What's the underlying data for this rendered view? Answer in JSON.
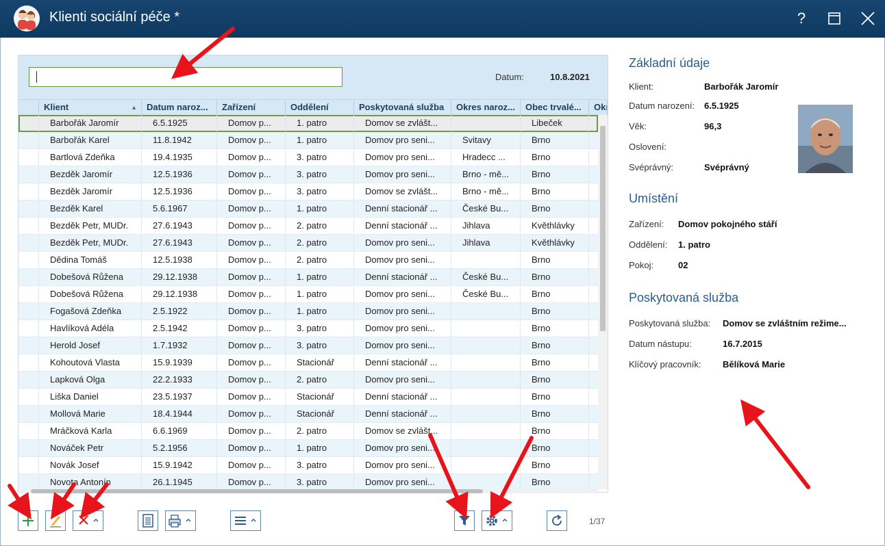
{
  "window": {
    "title": "Klienti sociální péče *",
    "help": "?",
    "maximize": "☐",
    "close": "✕"
  },
  "search": {
    "value": "",
    "placeholder": "",
    "date_label": "Datum:",
    "date_value": "10.8.2021"
  },
  "table": {
    "columns": [
      "Klient",
      "Datum naroz...",
      "Zařízení",
      "Oddělení",
      "Poskytovaná služba",
      "Okres naroz...",
      "Obec trvalé...",
      "Okr"
    ],
    "rows": [
      [
        "Barbořák Jaromír",
        "6.5.1925",
        "Domov p...",
        "1. patro",
        "Domov se zvlášt...",
        "",
        "Libeček"
      ],
      [
        "Barbořák Karel",
        "11.8.1942",
        "Domov p...",
        "1. patro",
        "Domov pro seni...",
        "Svitavy",
        "Brno"
      ],
      [
        "Bartlová Zdeňka",
        "19.4.1935",
        "Domov p...",
        "3. patro",
        "Domov pro seni...",
        "Hradecc ...",
        "Brno"
      ],
      [
        "Bezděk Jaromír",
        "12.5.1936",
        "Domov p...",
        "3. patro",
        "Domov pro seni...",
        "Brno - mě...",
        "Brno"
      ],
      [
        "Bezděk Jaromír",
        "12.5.1936",
        "Domov p...",
        "3. patro",
        "Domov se zvlášt...",
        "Brno - mě...",
        "Brno"
      ],
      [
        "Bezděk Karel",
        "5.6.1967",
        "Domov p...",
        "1. patro",
        "Denní stacionář ...",
        "České Bu...",
        "Brno"
      ],
      [
        "Bezděk Petr, MUDr.",
        "27.6.1943",
        "Domov p...",
        "2. patro",
        "Denní stacionář ...",
        "Jihlava",
        "Květhlávky"
      ],
      [
        "Bezděk Petr, MUDr.",
        "27.6.1943",
        "Domov p...",
        "2. patro",
        "Domov pro seni...",
        "Jihlava",
        "Květhlávky"
      ],
      [
        "Dědina Tomáš",
        "12.5.1938",
        "Domov p...",
        "2. patro",
        "Domov pro seni...",
        "",
        "Brno"
      ],
      [
        "Dobešová Růžena",
        "29.12.1938",
        "Domov p...",
        "1. patro",
        "Denní stacionář ...",
        "České Bu...",
        "Brno"
      ],
      [
        "Dobešová Růžena",
        "29.12.1938",
        "Domov p...",
        "1. patro",
        "Domov pro seni...",
        "České Bu...",
        "Brno"
      ],
      [
        "Fogašová Zdeňka",
        "2.5.1922",
        "Domov p...",
        "1. patro",
        "Domov pro seni...",
        "",
        "Brno"
      ],
      [
        "Havlíková Adéla",
        "2.5.1942",
        "Domov p...",
        "3. patro",
        "Domov pro seni...",
        "",
        "Brno"
      ],
      [
        "Herold Josef",
        "1.7.1932",
        "Domov p...",
        "3. patro",
        "Domov pro seni...",
        "",
        "Brno"
      ],
      [
        "Kohoutová Vlasta",
        "15.9.1939",
        "Domov p...",
        "Stacionář",
        "Denní stacionář ...",
        "",
        "Brno"
      ],
      [
        "Lapková Olga",
        "22.2.1933",
        "Domov p...",
        "2. patro",
        "Domov pro seni...",
        "",
        "Brno"
      ],
      [
        "Liška Daniel",
        "23.5.1937",
        "Domov p...",
        "Stacionář",
        "Denní stacionář ...",
        "",
        "Brno"
      ],
      [
        "Mollová Marie",
        "18.4.1944",
        "Domov p...",
        "Stacionář",
        "Denní stacionář ...",
        "",
        "Brno"
      ],
      [
        "Mráčková Karla",
        "6.6.1969",
        "Domov p...",
        "2. patro",
        "Domov se zvlášt...",
        "",
        "Brno"
      ],
      [
        "Nováček Petr",
        "5.2.1956",
        "Domov p...",
        "1. patro",
        "Domov pro seni...",
        "",
        "Brno"
      ],
      [
        "Novák Josef",
        "15.9.1942",
        "Domov p...",
        "3. patro",
        "Domov pro seni...",
        "",
        "Brno"
      ],
      [
        "Novota Antonín",
        "26.1.1945",
        "Domov p...",
        "3. patro",
        "Domov pro seni...",
        "",
        "Brno"
      ]
    ],
    "selected_row": 0,
    "pager": "1/37"
  },
  "details": {
    "basic": {
      "title": "Základní údaje",
      "klient_label": "Klient:",
      "klient": "Barbořák Jaromír",
      "birth_label": "Datum narození:",
      "birth": "6.5.1925",
      "age_label": "Věk:",
      "age": "96,3",
      "greeting_label": "Oslovení:",
      "greeting": "",
      "capacity_label": "Svéprávný:",
      "capacity": "Svéprávný"
    },
    "placement": {
      "title": "Umístění",
      "facility_label": "Zařízení:",
      "facility": "Domov pokojného stáří",
      "dept_label": "Oddělení:",
      "dept": "1. patro",
      "room_label": "Pokoj:",
      "room": "02"
    },
    "service": {
      "title": "Poskytovaná služba",
      "service_label": "Poskytovaná služba:",
      "service": "Domov se zvláštním režime...",
      "start_label": "Datum nástupu:",
      "start": "16.7.2015",
      "worker_label": "Klíčový pracovník:",
      "worker": "Bělíková Marie"
    }
  },
  "toolbar": {
    "add_icon": "plus-icon",
    "edit_icon": "pencil-icon",
    "delete_icon": "delete-x-icon",
    "report_icon": "document-icon",
    "print_icon": "printer-icon",
    "menu_icon": "hamburger-menu-icon",
    "filter_icon": "filter-icon",
    "settings_icon": "gear-icon",
    "refresh_icon": "refresh-icon"
  },
  "colors": {
    "titlebar": "#17456f",
    "accent": "#2b5c8a",
    "header_band": "#d6e8f5",
    "selection_border": "#6a9c4a",
    "annotation_arrow": "#e8141b"
  }
}
